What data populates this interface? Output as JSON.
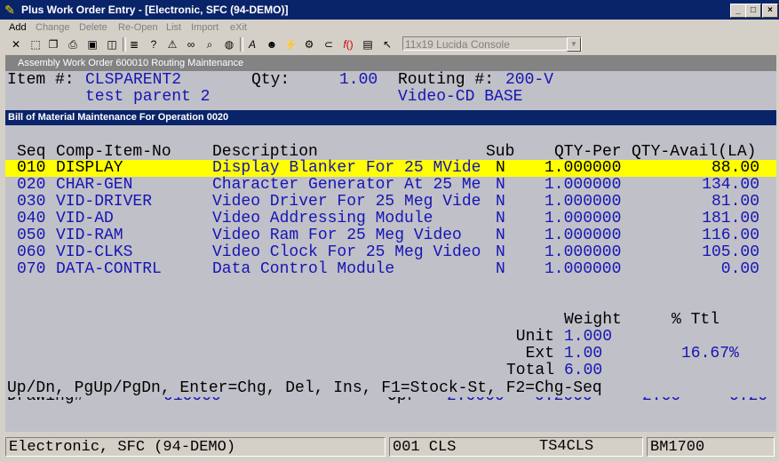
{
  "window": {
    "title": "Plus Work Order Entry - [Electronic, SFC (94-DEMO)]"
  },
  "menu": [
    "Add",
    "Change",
    "Delete",
    "Re-Open",
    "List",
    "Import",
    "eXit"
  ],
  "toolbar": {
    "font_select": "11x19 Lucida Console"
  },
  "panel": {
    "header": "Assembly Work Order 600010 Routing Maintenance",
    "item_label": "Item #:",
    "item_no": "CLSPARENT2",
    "item_desc": "test parent 2",
    "qty_label": "Qty:",
    "qty": "1.00",
    "routing_label": "Routing #:",
    "routing_no": "200-V",
    "routing_desc": "Video-CD BASE"
  },
  "bom": {
    "header": "Bill of Material Maintenance For Operation 0020",
    "columns": [
      "Seq",
      "Comp-Item-No",
      "Description",
      "Sub",
      "QTY-Per",
      "QTY-Avail(LA)"
    ],
    "rows": [
      [
        "010",
        "DISPLAY",
        "Display Blanker For 25 MVide",
        "N",
        "1.000000",
        "88.00"
      ],
      [
        "020",
        "CHAR-GEN",
        "Character Generator At 25 Me",
        "N",
        "1.000000",
        "134.00"
      ],
      [
        "030",
        "VID-DRIVER",
        "Video Driver For 25 Meg Vide",
        "N",
        "1.000000",
        "81.00"
      ],
      [
        "040",
        "VID-AD",
        "Video Addressing Module",
        "N",
        "1.000000",
        "181.00"
      ],
      [
        "050",
        "VID-RAM",
        "Video Ram For 25 Meg Video",
        "N",
        "1.000000",
        "116.00"
      ],
      [
        "060",
        "VID-CLKS",
        "Video Clock For 25 Meg Video",
        "N",
        "1.000000",
        "105.00"
      ],
      [
        "070",
        "DATA-CONTRL",
        "Data Control Module",
        "N",
        "1.000000",
        "0.00"
      ]
    ],
    "summary": {
      "weight_label": "Weight",
      "pct_label": "% Ttl",
      "unit_label": "Unit",
      "unit": "1.000",
      "ext_label": "Ext",
      "ext": "1.00",
      "ext_pct": "16.67%",
      "total_label": "Total",
      "total": "6.00"
    },
    "help": "Up/Dn, PgUp/PgDn, Enter=Chg, Del, Ins, F1=Stock-St, F2=Chg-Seq"
  },
  "behind": {
    "left": "Drawing#",
    "mid": "010000",
    "opr": "Opr",
    "v1": "2.0000",
    "v2": "0.2000",
    "v3": "2.00",
    "v4": "0.20"
  },
  "status": {
    "company": "Electronic, SFC (94-DEMO)",
    "user": "001 CLS",
    "terminal": "TS4CLS",
    "program": "BM1700"
  }
}
